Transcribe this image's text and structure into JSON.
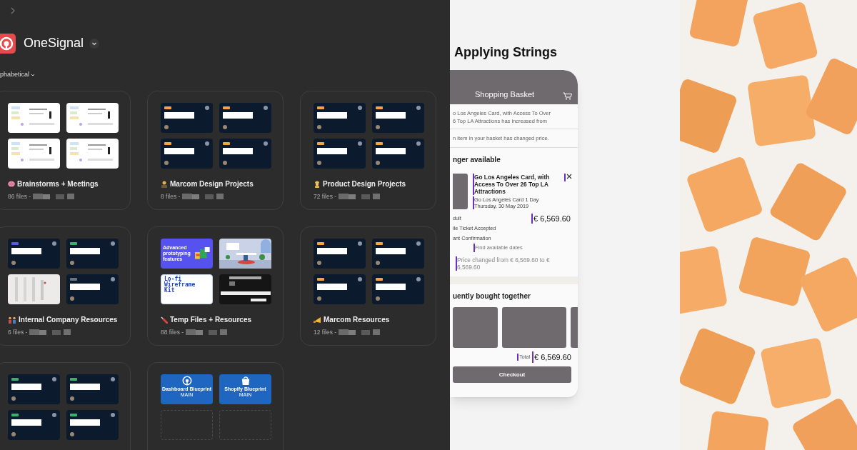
{
  "header": {
    "title": "OneSignal",
    "sort_label": "phabetical"
  },
  "projects": [
    {
      "title": "Brainstorms + Meetings",
      "files": "86 files -",
      "thumbnails": [
        {
          "kind": "whiteboard"
        },
        {
          "kind": "whiteboard"
        },
        {
          "kind": "whiteboard"
        },
        {
          "kind": "whiteboard"
        }
      ]
    },
    {
      "title": "Marcom Design Projects",
      "files": "8 files -",
      "thumbnails": [
        {
          "kind": "dark",
          "color": "#f2a541"
        },
        {
          "kind": "dark",
          "color": "#f2a541"
        },
        {
          "kind": "dark",
          "color": "#f2a541"
        },
        {
          "kind": "dark",
          "color": "#f2a541"
        }
      ]
    },
    {
      "title": "Product Design Projects",
      "files": "72 files -",
      "thumbnails": [
        {
          "kind": "dark",
          "color": "#f2a541"
        },
        {
          "kind": "dark",
          "color": "#f2a541"
        },
        {
          "kind": "dark",
          "color": "#f2a541"
        },
        {
          "kind": "dark",
          "color": "#f2a541"
        }
      ]
    },
    {
      "title": "Internal Company Resources",
      "files": "6 files -",
      "thumbnails": [
        {
          "kind": "dark",
          "color": "#5b5bd6"
        },
        {
          "kind": "dark",
          "color": "#3fae6a"
        },
        {
          "kind": "sheet"
        },
        {
          "kind": "dark",
          "color": "#6b7280"
        }
      ]
    },
    {
      "title": "Temp Files + Resources",
      "files": "88 files -",
      "thumbnails": [
        {
          "kind": "promo",
          "text": "Advanced prototyping features"
        },
        {
          "kind": "scene"
        },
        {
          "kind": "lofi",
          "text": "Lo-fi Wireframe Kit"
        },
        {
          "kind": "black"
        }
      ]
    },
    {
      "title": "Marcom Resources",
      "files": "12 files -",
      "thumbnails": [
        {
          "kind": "dark",
          "color": "#f2a541"
        },
        {
          "kind": "dark",
          "color": "#f2a541"
        },
        {
          "kind": "dark",
          "color": "#f2a541"
        },
        {
          "kind": "dark",
          "color": "#f2a541"
        }
      ]
    },
    {
      "thumbnails": [
        {
          "kind": "dark",
          "color": "#3fae6a"
        },
        {
          "kind": "dark",
          "color": "#3fae6a"
        },
        {
          "kind": "dark",
          "color": "#3fae6a"
        },
        {
          "kind": "dark",
          "color": "#3fae6a"
        }
      ]
    },
    {
      "thumbnails": [
        {
          "kind": "signal",
          "text": "Dashboard Blueprint",
          "badge": "MAIN"
        },
        {
          "kind": "shop",
          "text": "Shopify Blueprint",
          "badge": "MAIN"
        },
        {
          "kind": "empty"
        },
        {
          "kind": "empty"
        }
      ]
    }
  ],
  "mockup": {
    "title": "Applying Strings",
    "header": "Shopping Basket",
    "notice_lines": [
      "o Los Angeles Card, with Access To Over",
      "6 Top LA Attractions has increased from"
    ],
    "alert": "n item in your basket has changed price.",
    "section": "nger available",
    "item": {
      "title": "Go Los Angeles Card, with Access To Over 26 Top LA Attractions",
      "subtitle": "Go Los Angeles Card 1 Day",
      "date": "Thursday, 30 May 2019",
      "price": "€ 6,569.60",
      "details": [
        "dult",
        "ile Ticket Accepted",
        "ant Confirmation"
      ],
      "link": "Find available dates",
      "price_note": "Price changed from € 6,569.60 to € 6,569.60"
    },
    "related_title": "uently bought together",
    "total_label": "Total",
    "total": "€ 6,569.60",
    "checkout": "Checkout"
  }
}
